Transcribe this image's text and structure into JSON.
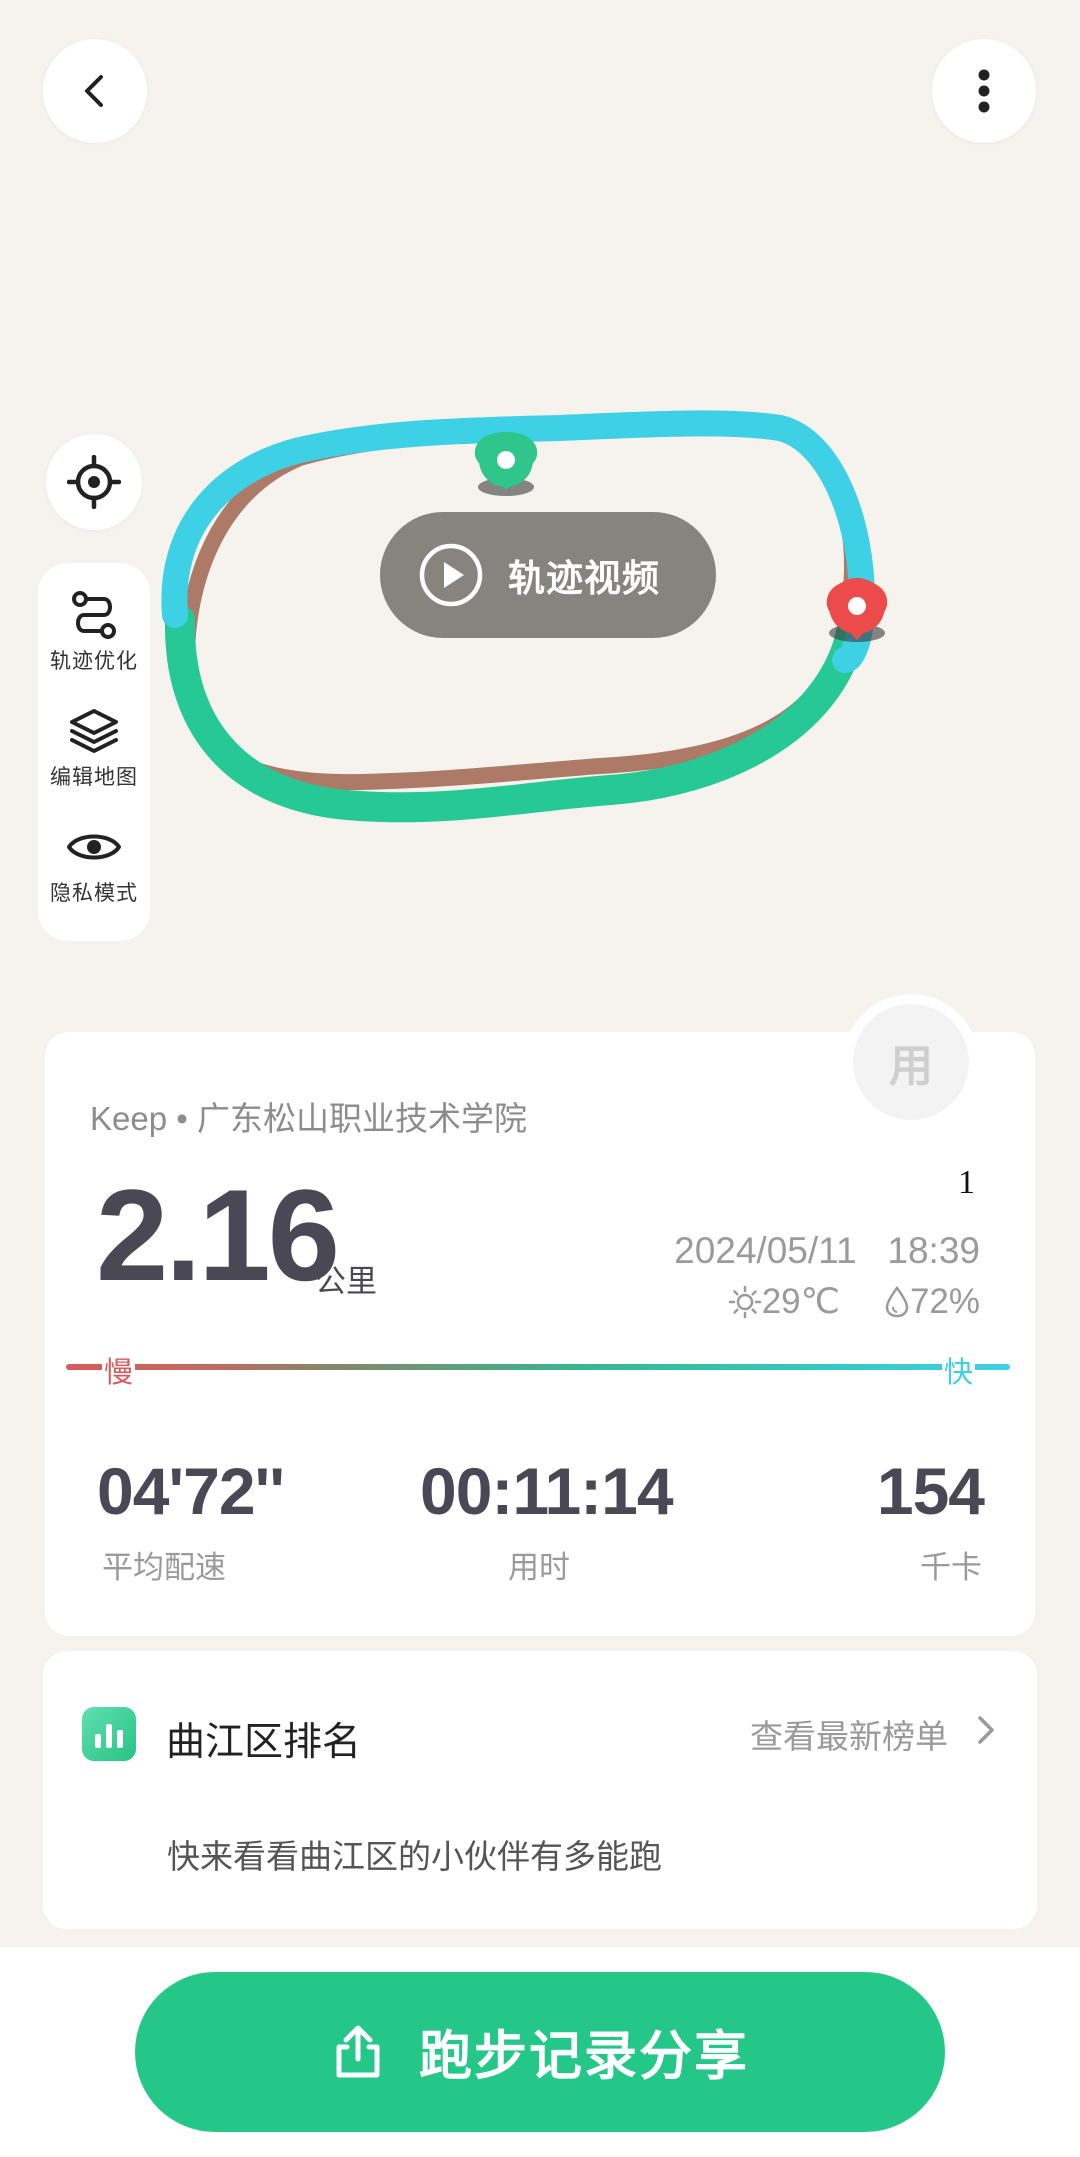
{
  "toolbar": {
    "back_icon": "chevron-left-icon",
    "more_icon": "vertical-dots-icon"
  },
  "map": {
    "locate_icon": "crosshair-icon",
    "tools": [
      {
        "label": "轨迹优化",
        "icon": "route-icon"
      },
      {
        "label": "编辑地图",
        "icon": "layers-icon"
      },
      {
        "label": "隐私模式",
        "icon": "eye-icon"
      }
    ],
    "play_label": "轨迹视频",
    "start_marker_color": "#2fc58b",
    "end_marker_color": "#ec4b4b",
    "track_colors": [
      "#3ed0e4",
      "#24c788",
      "#b0796a"
    ]
  },
  "summary": {
    "badge": "用",
    "source": "Keep • 广东松山职业技术学院",
    "distance": "2.16",
    "distance_unit": "公里",
    "marker": "1",
    "datetime": "2024/05/11   18:39",
    "temperature": "29℃",
    "humidity": "72%",
    "slow_label": "慢",
    "fast_label": "快",
    "stats": [
      {
        "value": "04'72''",
        "label": "平均配速"
      },
      {
        "value": "00:11:14",
        "label": "用时"
      },
      {
        "value": "154",
        "label": "千卡"
      }
    ]
  },
  "ranking": {
    "title": "曲江区排名",
    "link": "查看最新榜单",
    "description": "快来看看曲江区的小伙伴有多能跑"
  },
  "share": {
    "label": "跑步记录分享",
    "icon": "share-upload-icon",
    "color": "#24c788"
  }
}
